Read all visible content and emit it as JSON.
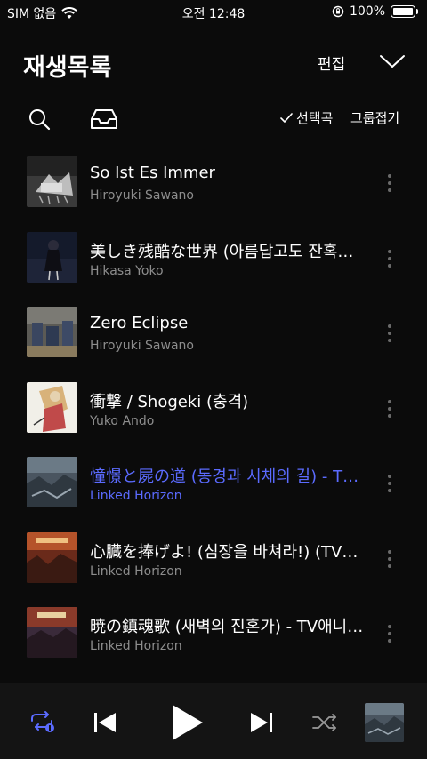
{
  "status": {
    "carrier": "SIM 없음",
    "time": "오전 12:48",
    "battery": "100%"
  },
  "header": {
    "title": "재생목록",
    "edit_label": "편집"
  },
  "toolbar": {
    "select_label": "선택곡",
    "group_label": "그룹접기"
  },
  "tracks": [
    {
      "title": "So Ist Es Immer",
      "artist": "Hiroyuki Sawano",
      "active": false
    },
    {
      "title": "美しき残酷な世界 (아름답고도 잔혹한 세계)",
      "artist": "Hikasa Yoko",
      "active": false
    },
    {
      "title": "Zero Eclipse",
      "artist": "Hiroyuki Sawano",
      "active": false
    },
    {
      "title": "衝撃 / Shogeki (충격)",
      "artist": "Yuko Ando",
      "active": false
    },
    {
      "title": "憧憬と屍の道 (동경과 시체의 길) - TV애니메이션",
      "artist": "Linked Horizon",
      "active": true
    },
    {
      "title": "心臓を捧げよ! (심장을 바쳐라!) (TV애니메이션)",
      "artist": "Linked Horizon",
      "active": false
    },
    {
      "title": "暁の鎮魂歌 (새벽의 진혼가) - TV애니메이션",
      "artist": "Linked Horizon",
      "active": false
    }
  ],
  "colors": {
    "accent": "#5b6bff",
    "background": "#0b0b0b",
    "secondary_text": "#8d8d8d"
  }
}
